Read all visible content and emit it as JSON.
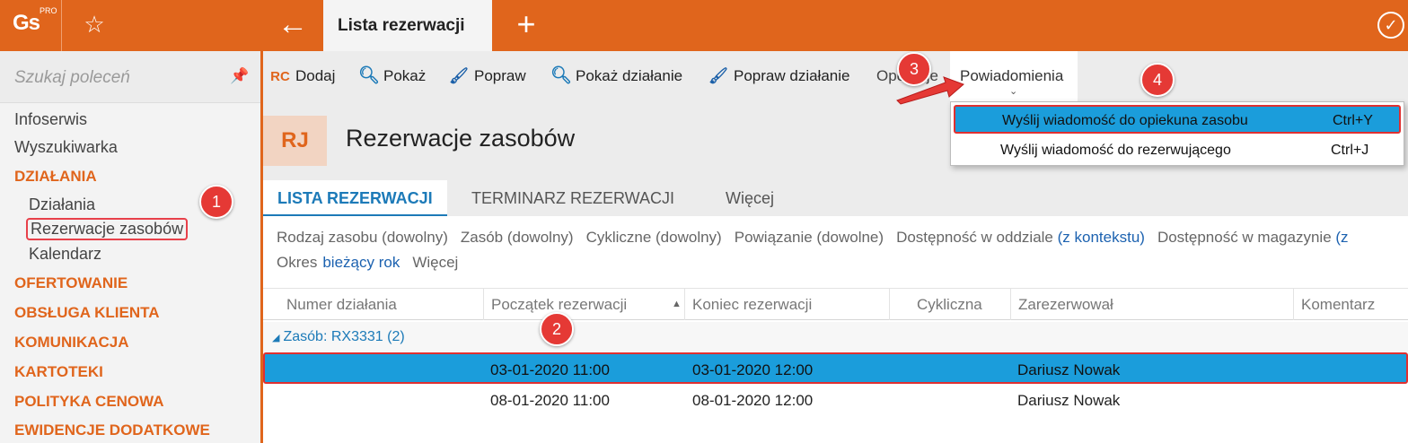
{
  "app": {
    "logo_text": "Gs",
    "logo_badge": "PRO",
    "active_tab": "Lista rezerwacji",
    "accent_color": "#e0651c"
  },
  "sidebar": {
    "search_placeholder": "Szukaj poleceń",
    "items": [
      {
        "label": "Infoserwis",
        "kind": "item"
      },
      {
        "label": "Wyszukiwarka",
        "kind": "item"
      },
      {
        "label": "DZIAŁANIA",
        "kind": "section"
      },
      {
        "label": "Działania",
        "kind": "sub"
      },
      {
        "label": "Rezerwacje zasobów",
        "kind": "sub-selected"
      },
      {
        "label": "Kalendarz",
        "kind": "sub"
      },
      {
        "label": "OFERTOWANIE",
        "kind": "section"
      },
      {
        "label": "OBSŁUGA KLIENTA",
        "kind": "section"
      },
      {
        "label": "KOMUNIKACJA",
        "kind": "section"
      },
      {
        "label": "KARTOTEKI",
        "kind": "section"
      },
      {
        "label": "POLITYKA CENOWA",
        "kind": "section"
      },
      {
        "label": "EWIDENCJE DODATKOWE",
        "kind": "section"
      }
    ]
  },
  "toolbar": {
    "add_icon_text": "RC",
    "add": "Dodaj",
    "show": "Pokaż",
    "edit": "Popraw",
    "show_action": "Pokaż działanie",
    "edit_action": "Popraw działanie",
    "operations": "Operacje",
    "notifications": "Powiadomienia"
  },
  "notifications_menu": [
    {
      "label": "Wyślij wiadomość do opiekuna zasobu",
      "shortcut": "Ctrl+Y"
    },
    {
      "label": "Wyślij wiadomość do rezerwującego",
      "shortcut": "Ctrl+J"
    }
  ],
  "header": {
    "badge": "RJ",
    "title": "Rezerwacje zasobów"
  },
  "tabs": {
    "list": "LISTA REZERWACJI",
    "schedule": "TERMINARZ REZERWACJI",
    "more": "Więcej"
  },
  "filters": {
    "resource_type": "Rodzaj zasobu (dowolny)",
    "resource": "Zasób (dowolny)",
    "cyclic": "Cykliczne (dowolny)",
    "relation": "Powiązanie (dowolne)",
    "branch_label": "Dostępność w oddziale",
    "branch_value": "(z kontekstu)",
    "warehouse_label": "Dostępność w magazynie",
    "warehouse_value": "(z",
    "period_label": "Okres",
    "period_value": "bieżący rok",
    "more": "Więcej"
  },
  "table": {
    "columns": [
      "Numer działania",
      "Początek rezerwacji",
      "Koniec rezerwacji",
      "Cykliczna",
      "Zarezerwował",
      "Komentarz"
    ],
    "group_label": "Zasób:",
    "group_value": "RX3331",
    "group_count": "(2)",
    "rows": [
      {
        "number": "",
        "start": "03-01-2020  11:00",
        "end": "03-01-2020  12:00",
        "cyclic": "",
        "reserved_by": "Dariusz Nowak",
        "comment": "",
        "selected": true
      },
      {
        "number": "",
        "start": "08-01-2020  11:00",
        "end": "08-01-2020  12:00",
        "cyclic": "",
        "reserved_by": "Dariusz Nowak",
        "comment": "",
        "selected": false
      }
    ]
  },
  "markers": [
    "1",
    "2",
    "3",
    "4"
  ],
  "colors": {
    "selection": "#1b9ddb",
    "highlight_border": "#e03030",
    "marker": "#e53935",
    "link": "#1c62b0"
  }
}
